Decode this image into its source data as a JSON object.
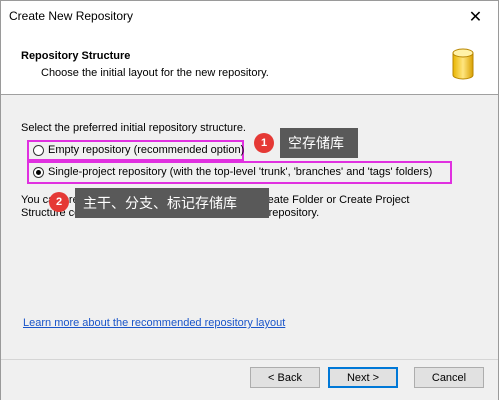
{
  "window": {
    "title": "Create New Repository",
    "close_glyph": "✕"
  },
  "header": {
    "title": "Repository Structure",
    "subtitle": "Choose the initial layout for the new repository.",
    "icon": "database-icon"
  },
  "main": {
    "prompt": "Select the preferred initial repository structure.",
    "options": [
      {
        "label": "Empty repository (recommended option)",
        "selected": false
      },
      {
        "label": "Single-project repository (with the top-level 'trunk', 'branches' and 'tags' folders)",
        "selected": true
      }
    ],
    "description_line1": "You can create the default layout later using the Create Folder or Create Project",
    "description_line2": "Structure context menu commands for the created repository."
  },
  "annotations": [
    {
      "number": "1",
      "text": "空存储库"
    },
    {
      "number": "2",
      "text": "主干、分支、标记存储库"
    }
  ],
  "link": "Learn more about the recommended repository layout",
  "buttons": {
    "back": "< Back",
    "next": "Next >",
    "cancel": "Cancel"
  },
  "colors": {
    "highlight": "#e030e0",
    "badge": "#e53935",
    "tooltip": "#595959",
    "link": "#1a55c9"
  }
}
